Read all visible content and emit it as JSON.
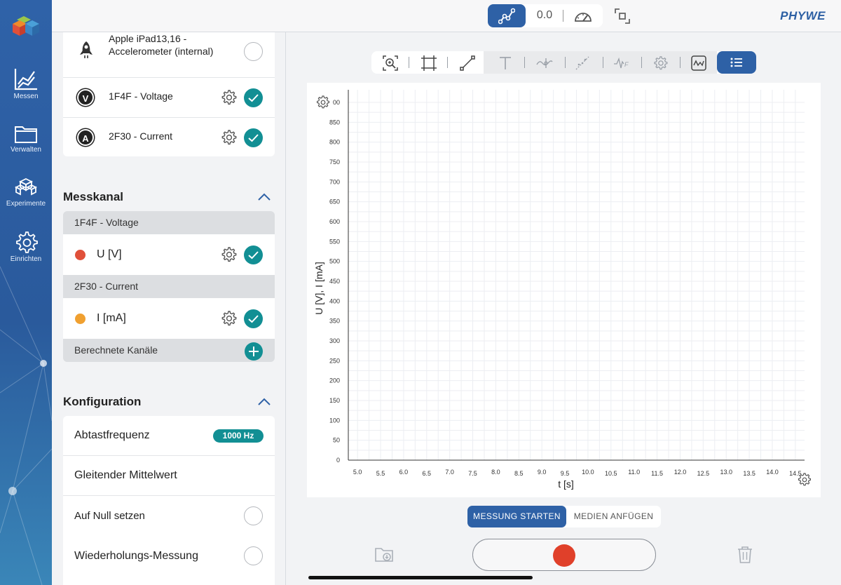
{
  "brand": "PHYWE",
  "topbar": {
    "value_display": "0.0"
  },
  "nav": [
    {
      "label": "Messen",
      "icon": "chart-line-icon"
    },
    {
      "label": "Verwalten",
      "icon": "folder-icon"
    },
    {
      "label": "Experimente",
      "icon": "cubes-icon"
    },
    {
      "label": "Einrichten",
      "icon": "gear-icon"
    }
  ],
  "sensors": [
    {
      "name": "Apple iPad13,16 - Accelerometer (internal)",
      "badge": "",
      "selected": false
    },
    {
      "name": "1F4F - Voltage",
      "badge": "V",
      "selected": true
    },
    {
      "name": "2F30 - Current",
      "badge": "A",
      "selected": true
    }
  ],
  "messkanal": {
    "title": "Messkanal",
    "groups": [
      {
        "header": "1F4F - Voltage",
        "channel": "U [V]",
        "color": "#e0503a"
      },
      {
        "header": "2F30 - Current",
        "channel": "I [mA]",
        "color": "#f0a030"
      }
    ],
    "computed": "Berechnete Kanäle"
  },
  "konfiguration": {
    "title": "Konfiguration",
    "sampling_label": "Abtastfrequenz",
    "sampling_value": "1000 Hz",
    "moving_average": "Gleitender Mittelwert",
    "zero": "Auf Null setzen",
    "repeat": "Wiederholungs-Messung"
  },
  "actions": {
    "start": "MESSUNG STARTEN",
    "media": "MEDIEN ANFÜGEN"
  },
  "chart_data": {
    "type": "line",
    "xlabel": "t [s]",
    "ylabel": "U [V], I [mA]",
    "xlim": [
      4.8,
      14.7
    ],
    "ylim": [
      0,
      700
    ],
    "x_ticks": [
      "5.0",
      "5.5",
      "6.0",
      "6.5",
      "7.0",
      "7.5",
      "8.0",
      "8.5",
      "9.0",
      "9.5",
      "10.0",
      "10.5",
      "11.0",
      "11.5",
      "12.0",
      "12.5",
      "13.0",
      "13.5",
      "14.0",
      "14.5"
    ],
    "y_ticks": [
      "0",
      "50",
      "100",
      "150",
      "200",
      "250",
      "300",
      "350",
      "400",
      "450",
      "500",
      "550",
      "600",
      "650",
      "700",
      "750",
      "800",
      "850",
      "00"
    ],
    "series": [],
    "grid": true
  }
}
